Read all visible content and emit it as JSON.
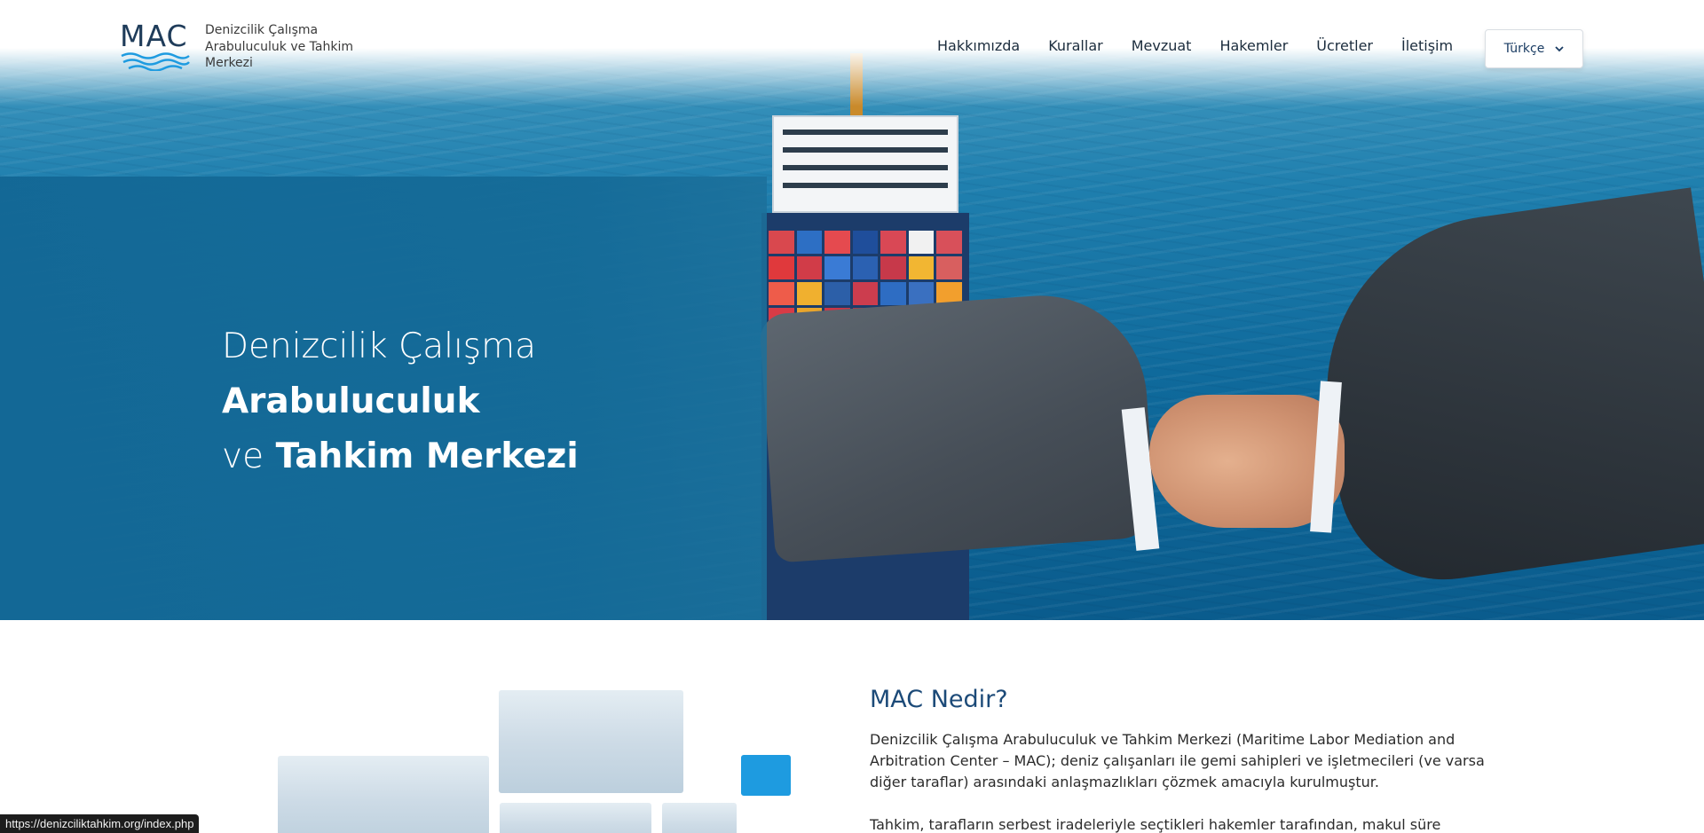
{
  "header": {
    "logo_abbr": "MAC",
    "logo_lines": [
      "Denizcilik Çalışma",
      "Arabuluculuk ve Tahkim",
      "Merkezi"
    ],
    "nav": [
      {
        "label": "Hakkımızda"
      },
      {
        "label": "Kurallar"
      },
      {
        "label": "Mevzuat"
      },
      {
        "label": "Hakemler"
      },
      {
        "label": "Ücretler"
      },
      {
        "label": "İletişim"
      }
    ],
    "language": {
      "selected": "Türkçe"
    }
  },
  "hero": {
    "line1": "Denizcilik Çalışma",
    "line2": "Arabuluculuk",
    "line3_light": "ve",
    "line3_bold": "Tahkim Merkezi"
  },
  "about": {
    "title": "MAC Nedir?",
    "paragraph1": "Denizcilik Çalışma Arabuluculuk ve Tahkim Merkezi (Maritime Labor Mediation and Arbitration Center – MAC); deniz çalışanları ile gemi sahipleri ve işletmecileri (ve varsa diğer taraflar) arasındaki anlaşmazlıkları çözmek amacıyla kurulmuştur.",
    "paragraph2": "Tahkim, tarafların serbest iradeleriyle seçtikleri hakemler tarafından, makul süre içerisinde,"
  },
  "statusbar": {
    "url": "https://denizciliktahkim.org/index.php"
  },
  "colors": {
    "primary": "#1c4a78",
    "hero_panel": "#136896",
    "accent": "#1e9be0",
    "nav_text": "#1b2c3d"
  },
  "icons": {
    "language_dropdown": "chevron-down-icon",
    "logo_waves": "waves-icon"
  }
}
